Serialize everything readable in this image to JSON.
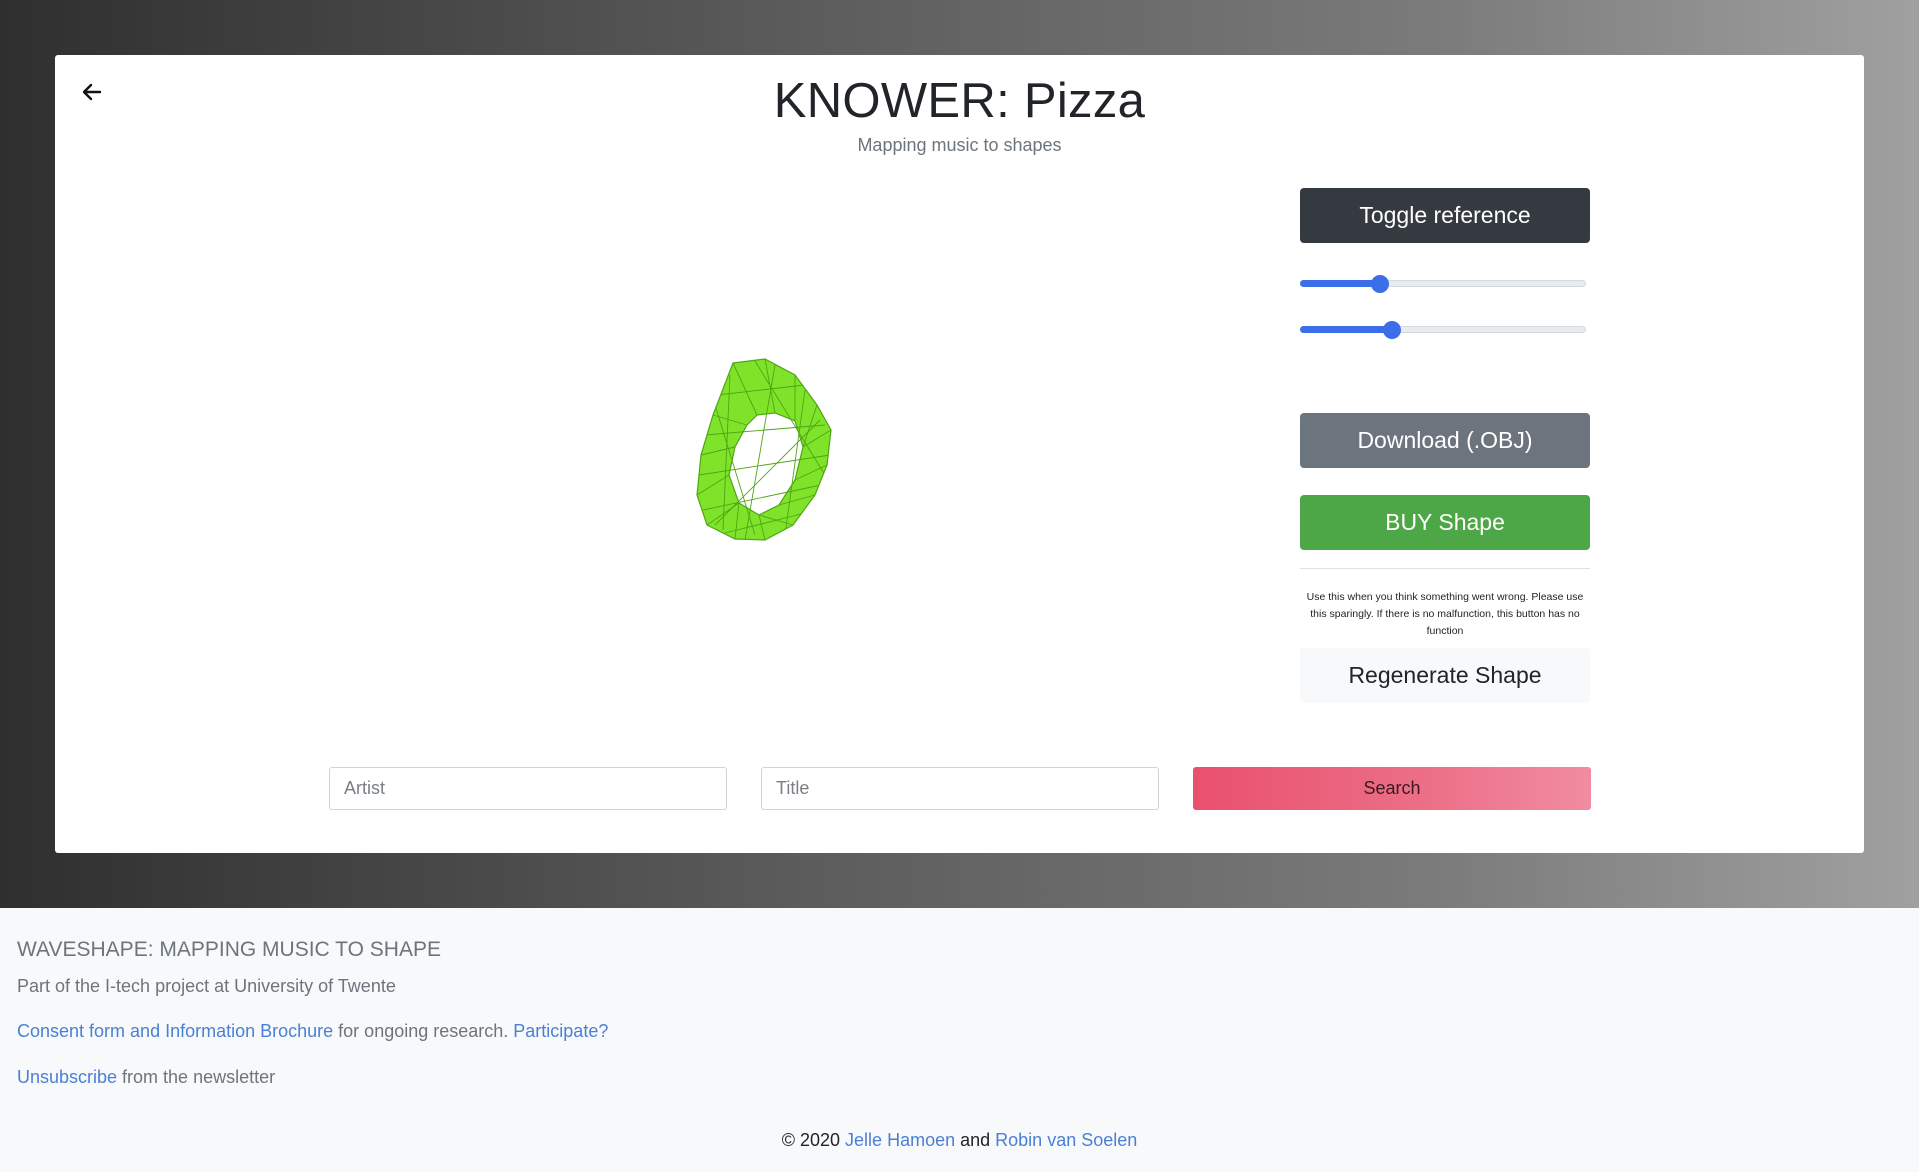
{
  "header": {
    "title": "KNOWER: Pizza",
    "subtitle": "Mapping music to shapes"
  },
  "viewer": {
    "shape_color": "#7fe32a",
    "edge_color": "#4fa514"
  },
  "controls": {
    "toggle_reference_label": "Toggle reference",
    "slider_1_value": 0.28,
    "slider_2_value": 0.32,
    "download_label": "Download (.OBJ)",
    "buy_label": "BUY Shape",
    "regenerate_note": "Use this when you think something went wrong. Please use this sparingly. If there is no malfunction, this button has no function",
    "regenerate_label": "Regenerate Shape"
  },
  "search": {
    "artist_placeholder": "Artist",
    "title_placeholder": "Title",
    "search_label": "Search"
  },
  "footer": {
    "heading": "WAVESHAPE: MAPPING MUSIC TO SHAPE",
    "project_line": "Part of the I-tech project at University of Twente",
    "consent_link": "Consent form and Information Brochure",
    "consent_text": " for ongoing research. ",
    "participate_link": "Participate?",
    "unsubscribe_link": "Unsubscribe",
    "unsubscribe_text": " from the newsletter",
    "copyright_prefix": "© 2020 ",
    "author_1": "Jelle Hamoen",
    "and_text": " and ",
    "author_2": "Robin van Soelen"
  },
  "colors": {
    "accent_blue": "#3b6ee8",
    "buy_green": "#4ea746",
    "search_pink": "#e9506e"
  }
}
